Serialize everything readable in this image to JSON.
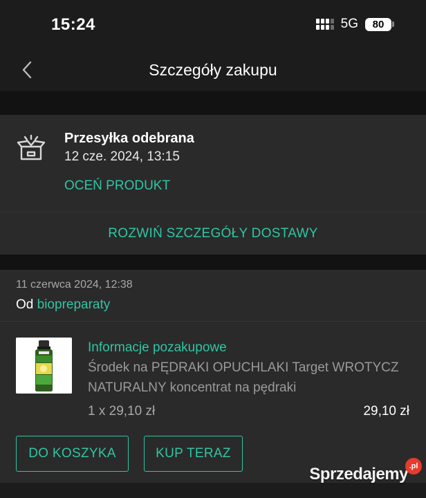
{
  "status_bar": {
    "time": "15:24",
    "network": "5G",
    "battery": "80"
  },
  "nav": {
    "title": "Szczegóły zakupu",
    "back_icon": "chevron-left-icon"
  },
  "delivery": {
    "icon": "package-open-icon",
    "title": "Przesyłka odebrana",
    "date": "12 cze. 2024, 13:15",
    "rate_label": "OCEŃ PRODUKT",
    "expand_label": "ROZWIŃ SZCZEGÓŁY DOSTAWY"
  },
  "order": {
    "date": "11 czerwca 2024, 12:38",
    "seller_prefix": "Od",
    "seller_name": "biopreparaty",
    "info_label": "Informacje pozakupowe",
    "product_name": "Środek na PĘDRAKI OPUCHLAKI Target WROTYCZ NATURALNY koncentrat na pędraki",
    "quantity_price": "1 x 29,10 zł",
    "total": "29,10 zł",
    "cart_button": "DO KOSZYKA",
    "buy_button": "KUP TERAZ"
  },
  "watermark": {
    "text": "Sprzedajemy",
    "badge": ".pl"
  },
  "colors": {
    "accent": "#2fc6a4",
    "background": "#1c1c1c",
    "card": "#2a2a2a"
  }
}
